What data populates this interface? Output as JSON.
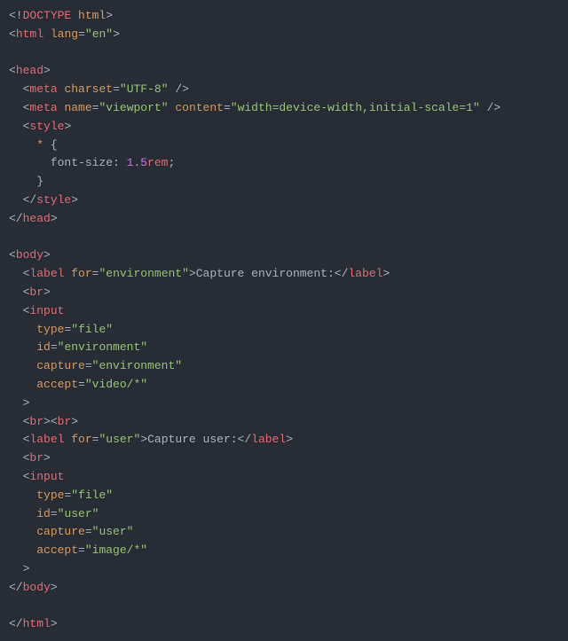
{
  "l1": {
    "open": "<!",
    "tag": "DOCTYPE",
    "attr": "html",
    "close": ">"
  },
  "l2": {
    "open": "<",
    "tag": "html",
    "attr": "lang",
    "eq": "=",
    "q1": "\"",
    "val": "en",
    "q2": "\"",
    "close": ">"
  },
  "l3": {
    "open": "<",
    "tag": "head",
    "close": ">"
  },
  "l4": {
    "indent": "  ",
    "open": "<",
    "tag": "meta",
    "attr": "charset",
    "eq": "=",
    "q1": "\"",
    "val": "UTF-8",
    "q2": "\"",
    "close": " />"
  },
  "l5": {
    "indent": "  ",
    "open": "<",
    "tag": "meta",
    "attr1": "name",
    "eq1": "=",
    "q1a": "\"",
    "val1": "viewport",
    "q1b": "\"",
    "attr2": "content",
    "eq2": "=",
    "q2a": "\"",
    "val2": "width=device-width,initial-scale=1",
    "q2b": "\"",
    "close": " />"
  },
  "l6": {
    "indent": "  ",
    "open": "<",
    "tag": "style",
    "close": ">"
  },
  "l7": {
    "indent": "    ",
    "sel": "*",
    "brace": " {"
  },
  "l8": {
    "indent": "      ",
    "prop": "font-size",
    "colon": ": ",
    "num": "1.5",
    "unit": "rem",
    "semi": ";"
  },
  "l9": {
    "indent": "    ",
    "brace": "}"
  },
  "l10": {
    "indent": "  ",
    "open": "</",
    "tag": "style",
    "close": ">"
  },
  "l11": {
    "open": "</",
    "tag": "head",
    "close": ">"
  },
  "l12": {
    "open": "<",
    "tag": "body",
    "close": ">"
  },
  "l13": {
    "indent": "  ",
    "open": "<",
    "tag": "label",
    "attr": "for",
    "eq": "=",
    "q1": "\"",
    "val": "environment",
    "q2": "\"",
    "close": ">",
    "text": "Capture environment:",
    "open2": "</",
    "tag2": "label",
    "close2": ">"
  },
  "l14": {
    "indent": "  ",
    "open": "<",
    "tag": "br",
    "close": ">"
  },
  "l15": {
    "indent": "  ",
    "open": "<",
    "tag": "input"
  },
  "l16": {
    "indent": "    ",
    "attr": "type",
    "eq": "=",
    "q1": "\"",
    "val": "file",
    "q2": "\""
  },
  "l17": {
    "indent": "    ",
    "attr": "id",
    "eq": "=",
    "q1": "\"",
    "val": "environment",
    "q2": "\""
  },
  "l18": {
    "indent": "    ",
    "attr": "capture",
    "eq": "=",
    "q1": "\"",
    "val": "environment",
    "q2": "\""
  },
  "l19": {
    "indent": "    ",
    "attr": "accept",
    "eq": "=",
    "q1": "\"",
    "val": "video/*",
    "q2": "\""
  },
  "l20": {
    "indent": "  ",
    "close": ">"
  },
  "l21": {
    "indent": "  ",
    "open": "<",
    "tag": "br",
    "close": ">",
    "open2": "<",
    "tag2": "br",
    "close2": ">"
  },
  "l22": {
    "indent": "  ",
    "open": "<",
    "tag": "label",
    "attr": "for",
    "eq": "=",
    "q1": "\"",
    "val": "user",
    "q2": "\"",
    "close": ">",
    "text": "Capture user:",
    "open2": "</",
    "tag2": "label",
    "close2": ">"
  },
  "l23": {
    "indent": "  ",
    "open": "<",
    "tag": "br",
    "close": ">"
  },
  "l24": {
    "indent": "  ",
    "open": "<",
    "tag": "input"
  },
  "l25": {
    "indent": "    ",
    "attr": "type",
    "eq": "=",
    "q1": "\"",
    "val": "file",
    "q2": "\""
  },
  "l26": {
    "indent": "    ",
    "attr": "id",
    "eq": "=",
    "q1": "\"",
    "val": "user",
    "q2": "\""
  },
  "l27": {
    "indent": "    ",
    "attr": "capture",
    "eq": "=",
    "q1": "\"",
    "val": "user",
    "q2": "\""
  },
  "l28": {
    "indent": "    ",
    "attr": "accept",
    "eq": "=",
    "q1": "\"",
    "val": "image/*",
    "q2": "\""
  },
  "l29": {
    "indent": "  ",
    "close": ">"
  },
  "l30": {
    "open": "</",
    "tag": "body",
    "close": ">"
  },
  "l31": {
    "open": "</",
    "tag": "html",
    "close": ">"
  }
}
